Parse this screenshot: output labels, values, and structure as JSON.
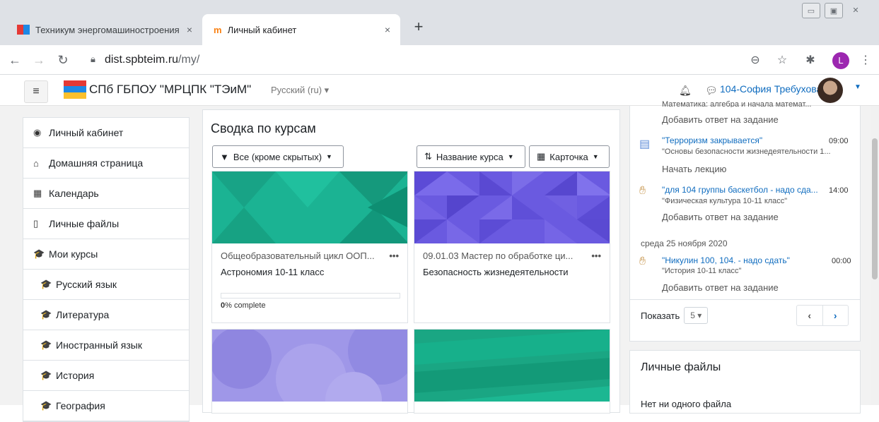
{
  "browser": {
    "tabs": [
      {
        "title": "Техникум энергомашиностроения",
        "close": "×"
      },
      {
        "title": "Личный кабинет",
        "close": "×"
      }
    ],
    "new_tab": "+",
    "url_host": "dist.spbteim.ru",
    "url_path": "/my/",
    "profile_letter": "L"
  },
  "header": {
    "site_name": "СПб ГБПОУ \"МРЦПК \"ТЭиМ\"",
    "language": "Русский (ru) ▾",
    "user_name": "104-София Требухова"
  },
  "sidebar": {
    "items": [
      {
        "label": "Личный кабинет",
        "icon": "tachometer-icon",
        "glyph": "◉"
      },
      {
        "label": "Домашняя страница",
        "icon": "home-icon",
        "glyph": "⌂"
      },
      {
        "label": "Календарь",
        "icon": "calendar-icon",
        "glyph": "▦"
      },
      {
        "label": "Личные файлы",
        "icon": "file-icon",
        "glyph": "▯"
      },
      {
        "label": "Мои курсы",
        "icon": "graduation-cap-icon",
        "glyph": "🎓"
      },
      {
        "label": "Русский язык",
        "icon": "graduation-cap-icon",
        "glyph": "🎓"
      },
      {
        "label": "Литература",
        "icon": "graduation-cap-icon",
        "glyph": "🎓"
      },
      {
        "label": "Иностранный язык",
        "icon": "graduation-cap-icon",
        "glyph": "🎓"
      },
      {
        "label": "История",
        "icon": "graduation-cap-icon",
        "glyph": "🎓"
      },
      {
        "label": "География",
        "icon": "graduation-cap-icon",
        "glyph": "🎓"
      }
    ]
  },
  "courses": {
    "heading": "Сводка по курсам",
    "filter": "Все (кроме скрытых)",
    "sort": "Название курса",
    "view": "Карточка",
    "cards": [
      {
        "category": "Общеобразовательный цикл ООП...",
        "name": "Астрономия 10-11 класс",
        "progress_pct": 0,
        "progress_label": "% complete",
        "progress_value": "0",
        "color": "#1bb393"
      },
      {
        "category": "09.01.03 Мастер по обработке ци...",
        "name": "Безопасность жизнедеятельности",
        "color": "#6a5ae0"
      },
      {
        "category": "",
        "name": "",
        "color": "#9f97e8"
      },
      {
        "category": "",
        "name": "",
        "color": "#1aa683"
      }
    ],
    "more": "•••"
  },
  "timeline": {
    "top_cut": "Математика: алгебра и начала математ...",
    "top_action": "Добавить ответ на задание",
    "events": [
      {
        "title": "\"Терроризм закрывается\"",
        "time": "09:00",
        "course": "\"Основы безопасности жизнедеятельности 1...",
        "action": "Начать лекцию"
      },
      {
        "title": "\"для 104 группы баскетбол - надо сда...",
        "time": "14:00",
        "course": "\"Физическая культура 10-11 класс\"",
        "action": "Добавить ответ на задание"
      },
      {
        "title": "\"Никулин 100, 104. - надо сдать\"",
        "time": "00:00",
        "course": "\"История 10-11 класс\"",
        "action": "Добавить ответ на задание"
      }
    ],
    "date_header": "среда 25 ноября 2020",
    "show_label": "Показать",
    "show_count": "5 ▾",
    "prev": "‹",
    "next": "›"
  },
  "files": {
    "title": "Личные файлы",
    "empty": "Нет ни одного файла"
  }
}
